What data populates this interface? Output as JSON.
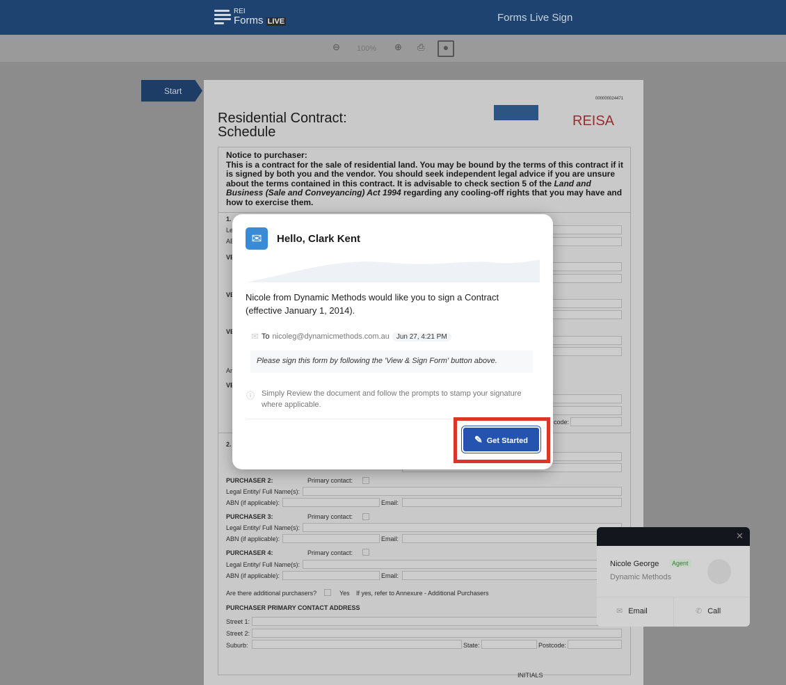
{
  "header": {
    "logo_small": "REI",
    "logo_main": "Forms",
    "logo_live": "LIVE",
    "title": "Forms Live Sign",
    "brand_color": "#1e4370"
  },
  "toolbar": {
    "zoom_level": "100%",
    "icons": [
      "zoom-out-icon",
      "zoom-in-icon",
      "print-icon",
      "user-icon"
    ]
  },
  "nav": {
    "start_label": "Start"
  },
  "document": {
    "doc_number": "000000024471",
    "title_line1": "Residential Contract:",
    "title_line2": "Schedule",
    "reisa": "REISA",
    "notice_heading": "Notice to purchaser:",
    "notice_text_1": "This is a contract for the sale of residential land. You may be bound by the terms of this contract if it is signed by both you and the vendor. You should seek independent legal advice if you are unsure about the terms contained in this contract.  It is advisable to check section 5 of the ",
    "notice_act": "Land and Business (Sale and Conveyancing) Act 1994",
    "notice_text_2": " regarding any cooling-off rights that you may have and how to exercise them.",
    "sec1": "1.",
    "sec2": "2.",
    "legal_label": "Legal Entity/ Full Name(s):",
    "abn_label": "ABN (if applicable):",
    "email_label": "Email:",
    "primary_label": "Primary contact:",
    "ve": "VE",
    "an": "An",
    "street1": "Street 1:",
    "street2": "Street 2:",
    "suburb": "Suburb:",
    "state": "State:",
    "postcode": "Postcode:",
    "code_frag": "code:",
    "purchasers": [
      "PURCHASER 2:",
      "PURCHASER 3:",
      "PURCHASER 4:"
    ],
    "additional_q": "Are there additional purchasers?",
    "yes": "Yes",
    "additional_note": "If yes, refer to Annexure - Additional Purchasers",
    "address_heading": "PURCHASER PRIMARY CONTACT ADDRESS",
    "initials": "INITIALS"
  },
  "modal": {
    "greeting": "Hello, Clark Kent",
    "message": "Nicole from Dynamic Methods would like you to sign a Contract (effective January 1, 2014).",
    "to_label": "To",
    "to_email": "nicoleg@dynamicmethods.com.au",
    "timestamp": "Jun 27, 4:21 PM",
    "note": "Please sign this form by following the 'View & Sign Form' button above.",
    "info": "Simply Review the document and follow the prompts to stamp your signature where applicable.",
    "button_label": "Get Started",
    "button_color": "#2454b0",
    "highlight_color": "#d9372b"
  },
  "agent_card": {
    "name": "Nicole George",
    "role": "Agent",
    "company": "Dynamic Methods",
    "email_label": "Email",
    "call_label": "Call"
  }
}
